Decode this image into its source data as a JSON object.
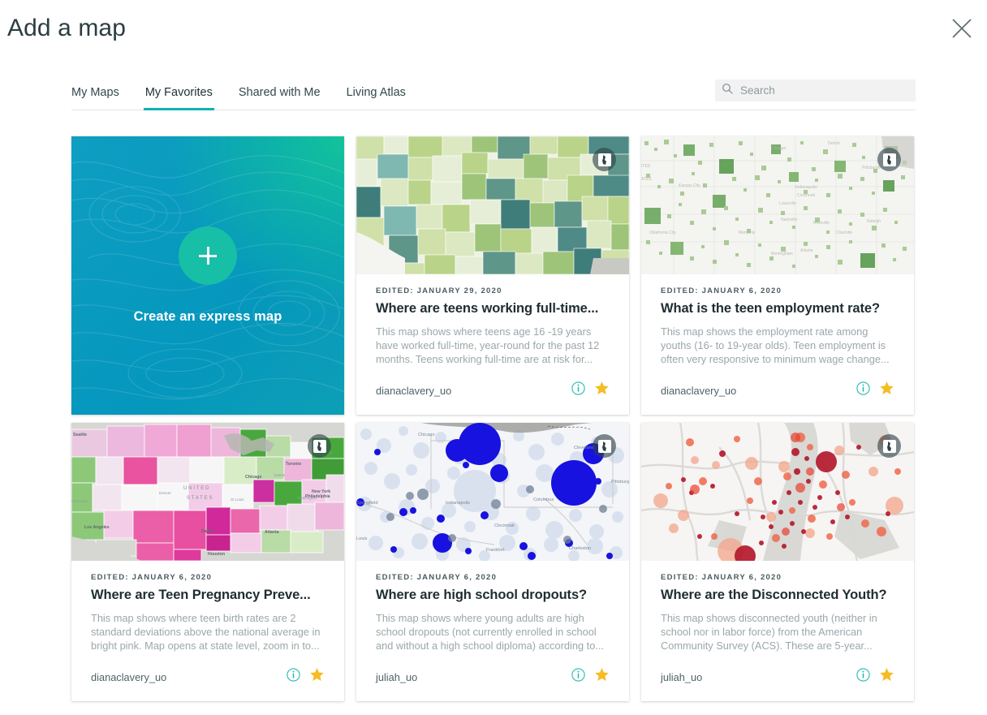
{
  "header": {
    "title": "Add a map",
    "close_label": "Close",
    "close_icon": "close-icon"
  },
  "tabs": [
    {
      "label": "My Maps",
      "active": false
    },
    {
      "label": "My Favorites",
      "active": true
    },
    {
      "label": "Shared with Me",
      "active": false
    },
    {
      "label": "Living Atlas",
      "active": false
    }
  ],
  "search": {
    "placeholder": "Search",
    "value": "",
    "icon": "search-icon"
  },
  "express": {
    "label": "Create an express map",
    "icon": "plus-icon",
    "gradient_from": "#0e9ec2",
    "gradient_to": "#12c39a",
    "circle_color": "#17bfa6"
  },
  "colors": {
    "accent_teal": "#0ab3ad",
    "star_gold": "#f6bc23",
    "title_dark": "#1f2d31",
    "desc_gray": "#9aa7ab"
  },
  "cards": [
    {
      "edited": "EDITED: JANUARY 29, 2020",
      "title": "Where are teens working full-time...",
      "description": "This map shows where teens age 16 -19 years have worked full-time, year-round for the past 12 months. Teens working full-time are at risk for...",
      "owner": "dianaclavery_uo",
      "thumb_style": "county-choropleth-green",
      "badge_icon": "map-area-icon",
      "info_icon": "info-icon",
      "favorite_icon": "star-filled-icon"
    },
    {
      "edited": "EDITED: JANUARY 6, 2020",
      "title": "What is the teen employment rate?",
      "description": "This map shows the employment rate among youths (16- to 19-year olds). Teen employment is often very responsive to minimum wage change...",
      "owner": "dianaclavery_uo",
      "thumb_style": "dot-density-green",
      "badge_icon": "map-area-icon",
      "info_icon": "info-icon",
      "favorite_icon": "star-filled-icon"
    },
    {
      "edited": "EDITED: JANUARY 6, 2020",
      "title": "Where are Teen Pregnancy Preve...",
      "description": "This map shows where teen birth rates are 2 standard deviations above the national average in bright pink. Map opens at state level, zoom in to...",
      "owner": "dianaclavery_uo",
      "thumb_style": "state-choropleth-pink",
      "badge_icon": "map-area-icon",
      "info_icon": "info-icon",
      "favorite_icon": "star-filled-icon"
    },
    {
      "edited": "EDITED: JANUARY 6, 2020",
      "title": "Where are high school dropouts?",
      "description": "This map shows where young adults are high school dropouts (not currently enrolled in school and without a high school diploma) according to...",
      "owner": "juliah_uo",
      "thumb_style": "bubble-blue",
      "badge_icon": "map-area-icon",
      "info_icon": "info-icon",
      "favorite_icon": "star-filled-icon"
    },
    {
      "edited": "EDITED: JANUARY 6, 2020",
      "title": "Where are the Disconnected Youth?",
      "description": "This map shows disconnected youth (neither in school nor in labor force) from the American Community Survey (ACS). These are 5-year...",
      "owner": "juliah_uo",
      "thumb_style": "dot-red",
      "badge_icon": "map-area-icon",
      "info_icon": "info-icon",
      "favorite_icon": "star-filled-icon"
    }
  ]
}
